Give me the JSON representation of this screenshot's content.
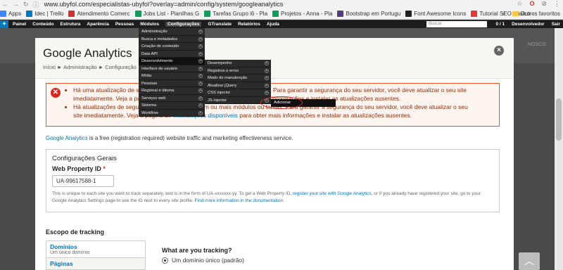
{
  "browser": {
    "url": "www.ubyfol.com/especialistas-ubyfol?overlay=admin/config/system/googleanalytics",
    "right_icons": [
      "star-icon",
      "opera-icon",
      "extension-icon",
      "menu-icon"
    ],
    "bookmarks": [
      {
        "label": "Apps",
        "color": "#4285f4"
      },
      {
        "label": "Idec | Trello",
        "color": "#0079bf"
      },
      {
        "label": "Atendimento Comerc",
        "color": "#d32f2f"
      },
      {
        "label": "Jobs List - Planilhas G",
        "color": "#0f9d58"
      },
      {
        "label": "Tarefas Grupo i6 - Pla",
        "color": "#0f9d58"
      },
      {
        "label": "Projetos - Anna - Pla",
        "color": "#0f9d58"
      },
      {
        "label": "Bootstrap em Portugu",
        "color": "#563d7c"
      },
      {
        "label": "Font Awesome Icons",
        "color": "#222222"
      },
      {
        "label": "Tutorial SEO Básico -",
        "color": "#e53935"
      }
    ],
    "more": "»",
    "other_bookmarks": "Outros favoritos"
  },
  "toolbar": {
    "items": [
      "Painel",
      "Conteúdo",
      "Estrutura",
      "Aparência",
      "Pessoas",
      "Módulos",
      "Configurações",
      "GTranslate",
      "Relatórios",
      "Ajuda"
    ],
    "search_placeholder": "Buscar",
    "counter": "0 / 1",
    "user": "Desenvolvedor",
    "logout": "Sair"
  },
  "bg_text": "NOSCO",
  "dialog": {
    "title": "Google Analytics",
    "breadcrumb": "Início ► Administração ► Configuração",
    "close_symbol": "×"
  },
  "messages": {
    "line1a": "Há uma atualização de segurança disponível para a sua versão do Drupal. Para garantir a segurança do seu servidor, você deve atualizar o seu site",
    "line1b": "imediatamente. Veja a página de atualizações disponíveis para obter mais informações e instalar as atualizações ausentes.",
    "line2a": "Há atualizações de segurança disponíveis para um ou mais módulos ou temas. Para garantir a segurança do seu servidor, você deve atualizar o seu",
    "line2b_pre": "site imediatamente. Veja a página de",
    "line2b_link": "atualizações disponíveis",
    "line2b_post": "para obter mais informações e instalar as atualizações ausentes."
  },
  "description": {
    "link": "Google Analytics",
    "text": " is a free (registration required) website traffic and marketing effectiveness service."
  },
  "general": {
    "legend": "Configurações Gerais",
    "label": "Web Property ID",
    "required": "*",
    "value": "UA-99617588-1",
    "help1": "This is unique to each site you want to track separately, and is in the form of UA-xxxxxxx-yy. To get a Web Property ID, ",
    "help_link1": "register your site with Google Analytics",
    "help2": ", or if you already have registered your site, go to your Google Analytics Settings page to see the ID next to every site profile. ",
    "help_link2": "Find more information in the documentation",
    "help3": "."
  },
  "tracking": {
    "scope_title": "Escopo de tracking",
    "tabs": [
      {
        "title": "Domínios",
        "subtitle": "Um único domínio"
      },
      {
        "title": "Páginas",
        "subtitle": ""
      }
    ],
    "question": "What are you tracking?",
    "option1": "Um domínio único (padrão)"
  },
  "menus": {
    "config": [
      "Administração",
      "Busca e metadados",
      "Criação de conteúdo",
      "Data API",
      "Desenvolvimento",
      "Interface de usuário",
      "Mídia",
      "Pessoas",
      "Regional e idioma",
      "Serviços web",
      "Sistema",
      "Workflow"
    ],
    "dev": [
      "Desempenho",
      "Registros e erros",
      "Modo de manutenção",
      "Atualizar jQuery",
      "CSS injector",
      "JS injector"
    ],
    "add": "Adicionar",
    "plus_symbol": "+"
  },
  "totop_symbol": "︿"
}
